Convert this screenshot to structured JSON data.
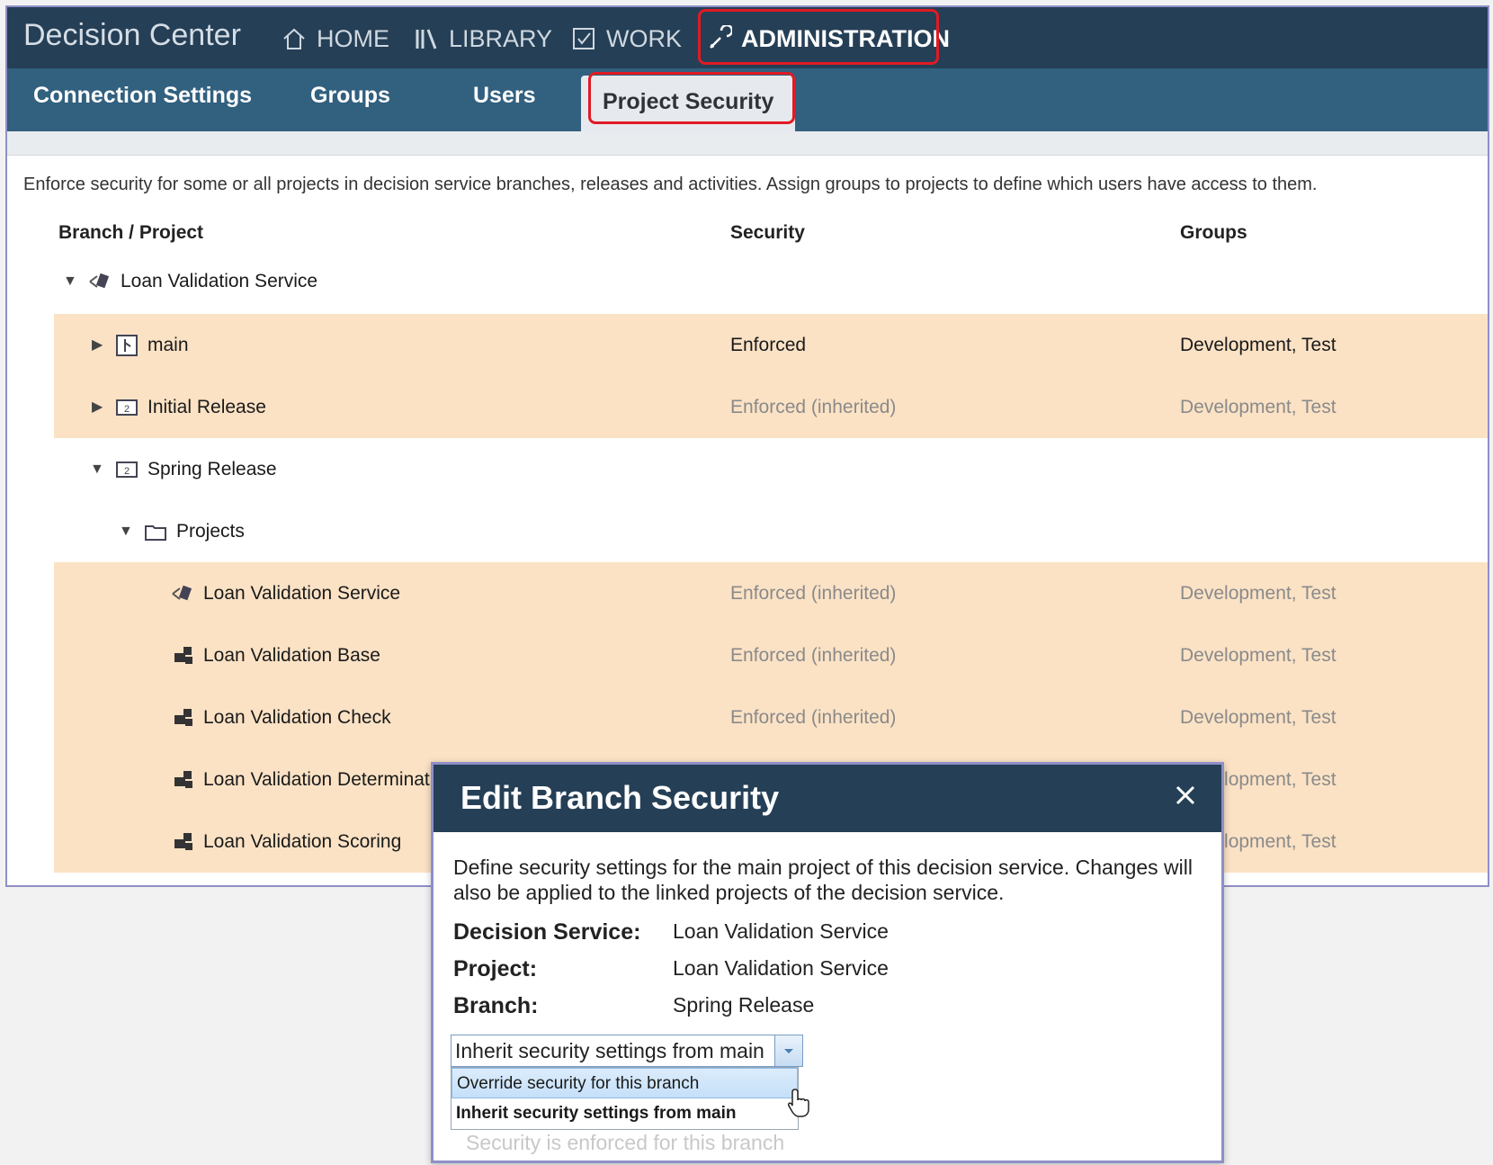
{
  "app": {
    "title": "Decision Center",
    "nav": [
      {
        "label": "HOME",
        "icon": "home-icon"
      },
      {
        "label": "LIBRARY",
        "icon": "library-icon"
      },
      {
        "label": "WORK",
        "icon": "checkbox-icon"
      },
      {
        "label": "ADMINISTRATION",
        "icon": "wrench-icon",
        "active": true
      }
    ],
    "subtabs": [
      "Connection Settings",
      "Groups",
      "Users",
      "Project Security"
    ],
    "active_subtab": "Project Security"
  },
  "main": {
    "description": "Enforce security for some or all projects in decision service branches, releases and activities. Assign groups to projects to define which users have access to them.",
    "columns": {
      "branch": "Branch / Project",
      "security": "Security",
      "groups": "Groups"
    },
    "rows": [
      {
        "name": "Loan Validation Service",
        "icon": "decision-service-icon",
        "expander": "expanded",
        "security": "",
        "groups": ""
      },
      {
        "name": "main",
        "icon": "branch-icon",
        "expander": "collapsed",
        "security": "Enforced",
        "groups": "Development, Test"
      },
      {
        "name": "Initial Release",
        "icon": "release-icon",
        "expander": "collapsed",
        "security": "Enforced (inherited)",
        "groups": "Development, Test"
      },
      {
        "name": "Spring Release",
        "icon": "release-icon",
        "expander": "expanded",
        "security": "",
        "groups": ""
      },
      {
        "name": "Projects",
        "icon": "folder-icon",
        "expander": "expanded",
        "security": "",
        "groups": ""
      },
      {
        "name": "Loan Validation Service",
        "icon": "decision-service-icon",
        "security": "Enforced (inherited)",
        "groups": "Development, Test"
      },
      {
        "name": "Loan Validation Base",
        "icon": "project-icon",
        "security": "Enforced (inherited)",
        "groups": "Development, Test"
      },
      {
        "name": "Loan Validation Check",
        "icon": "project-icon",
        "security": "Enforced (inherited)",
        "groups": "Development, Test"
      },
      {
        "name": "Loan Validation Determinat",
        "icon": "project-icon",
        "security": "",
        "groups": "Development, Test"
      },
      {
        "name": "Loan Validation Scoring",
        "icon": "project-icon",
        "security": "",
        "groups": "Development, Test"
      }
    ]
  },
  "dialog": {
    "title": "Edit Branch Security",
    "description": "Define security settings for the main project of this decision service. Changes will also be applied to the linked projects of the decision service.",
    "fields": [
      {
        "label": "Decision Service:",
        "value": "Loan Validation Service"
      },
      {
        "label": "Project:",
        "value": "Loan Validation Service"
      },
      {
        "label": "Branch:",
        "value": "Spring Release"
      }
    ],
    "select_value": "Inherit security settings from main",
    "options": [
      "Override security for this branch",
      "Inherit security settings from main"
    ],
    "note": "Security is enforced for this branch"
  },
  "colors": {
    "topbar": "#253f56",
    "subbar": "#32607f",
    "highlight_row": "#fbe2c5",
    "annotation": "#e01b24"
  }
}
